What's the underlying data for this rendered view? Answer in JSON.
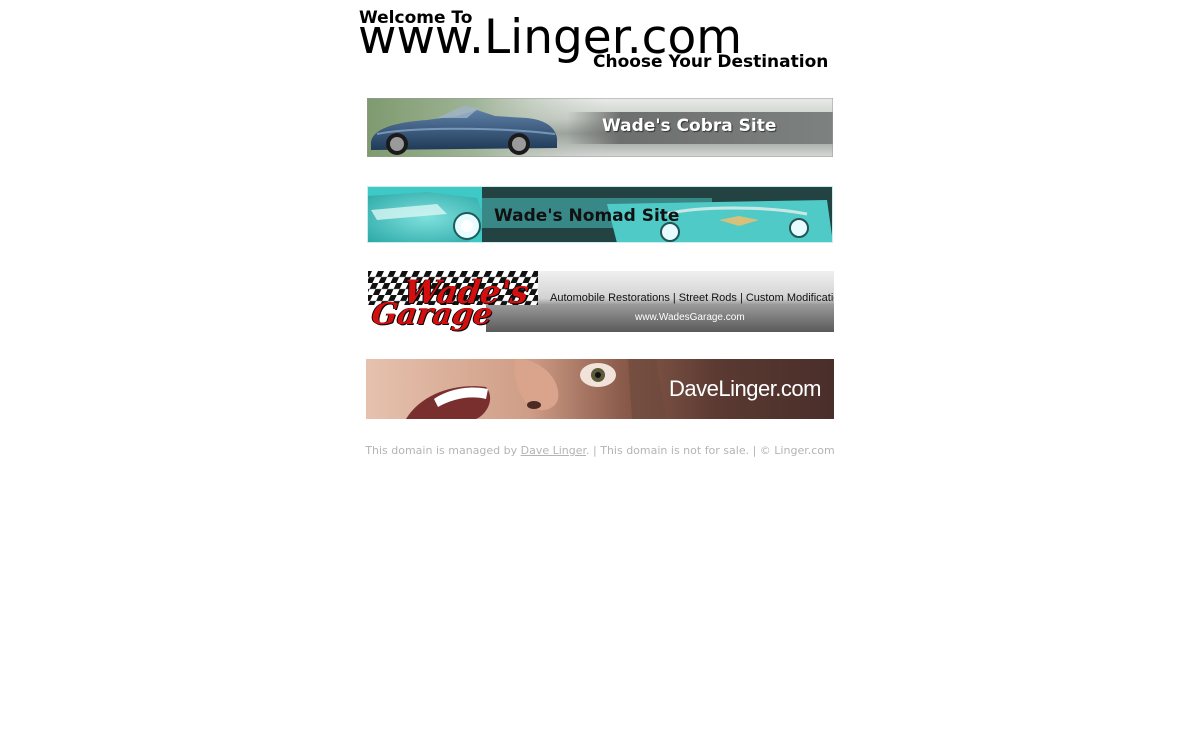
{
  "header": {
    "welcome": "Welcome To",
    "domain": "www.Linger.com",
    "tagline": "Choose Your Destination"
  },
  "banners": {
    "cobra": {
      "label": "Wade's Cobra Site"
    },
    "nomad": {
      "label": "Wade's Nomad Site"
    },
    "garage": {
      "logo_line1": "Wade's",
      "logo_line2": "Garage",
      "tagline": "Automobile Restorations | Street Rods | Custom Modifications",
      "url": "www.WadesGarage.com"
    },
    "dave": {
      "label": "DaveLinger.com"
    }
  },
  "footer": {
    "prefix": "This domain is managed by ",
    "link": "Dave Linger",
    "suffix": ". | This domain is not for sale. | © Linger.com"
  },
  "colors": {
    "footer_text": "#b4b4b4",
    "garage_red": "#d40f0f",
    "nomad_teal": "#3ec9c6",
    "cobra_blue": "#34577c"
  }
}
